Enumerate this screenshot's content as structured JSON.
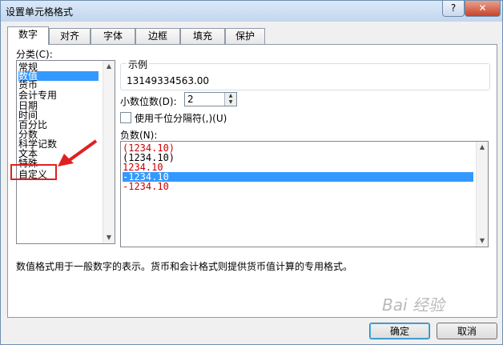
{
  "window": {
    "title": "设置单元格格式",
    "help_label": "?",
    "close_label": "✕"
  },
  "tabs": [
    {
      "label": "数字",
      "active": true
    },
    {
      "label": "对齐"
    },
    {
      "label": "字体"
    },
    {
      "label": "边框"
    },
    {
      "label": "填充"
    },
    {
      "label": "保护"
    }
  ],
  "category": {
    "label": "分类(C):",
    "items": [
      "常规",
      "数值",
      "货币",
      "会计专用",
      "日期",
      "时间",
      "百分比",
      "分数",
      "科学记数",
      "文本",
      "特殊",
      "自定义"
    ],
    "selected": "数值",
    "highlighted": "自定义"
  },
  "sample": {
    "legend": "示例",
    "value": "13149334563.00"
  },
  "decimal": {
    "label": "小数位数(D):",
    "value": "2"
  },
  "thousands": {
    "label": "使用千位分隔符(,)(U)",
    "checked": false
  },
  "negative": {
    "label": "负数(N):",
    "items": [
      {
        "text": "(1234.10)",
        "color": "#cc0000"
      },
      {
        "text": "(1234.10)",
        "color": "#000000"
      },
      {
        "text": "1234.10",
        "color": "#cc0000"
      },
      {
        "text": "-1234.10",
        "color": "#ffffff",
        "selected": true
      },
      {
        "text": "-1234.10",
        "color": "#cc0000"
      }
    ]
  },
  "description": "数值格式用于一般数字的表示。货币和会计格式则提供货币值计算的专用格式。",
  "buttons": {
    "ok": "确定",
    "cancel": "取消"
  },
  "watermark": "Bai 经验",
  "colors": {
    "selection": "#3399ff",
    "annotation": "#e02020"
  }
}
